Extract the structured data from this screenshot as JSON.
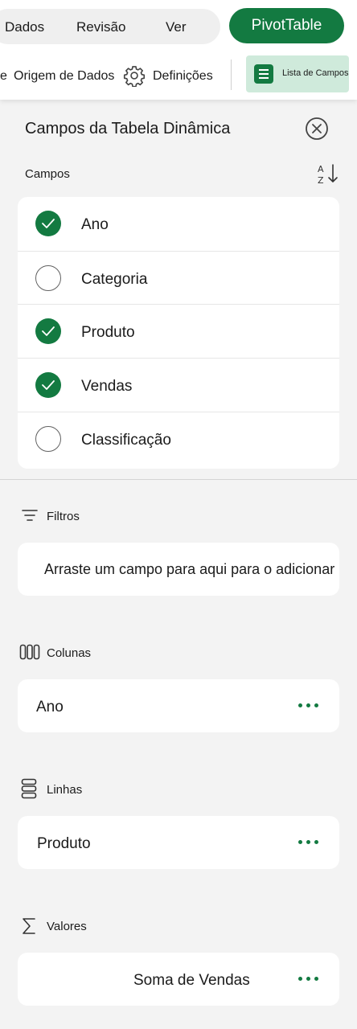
{
  "ribbon": {
    "tabs": [
      "Dados",
      "Revisão",
      "Ver"
    ],
    "pivot_button": "PivotTable",
    "commands": {
      "partial_prev": "e",
      "data_source": "Origem de Dados",
      "settings": "Definições",
      "field_list": "Lista de Campos"
    }
  },
  "panel": {
    "title": "Campos da Tabela Dinâmica",
    "fields_label": "Campos",
    "fields": [
      {
        "label": "Ano",
        "checked": true
      },
      {
        "label": "Categoria",
        "checked": false
      },
      {
        "label": "Produto",
        "checked": true
      },
      {
        "label": "Vendas",
        "checked": true
      },
      {
        "label": "Classificação",
        "checked": false
      }
    ],
    "filters": {
      "label": "Filtros",
      "placeholder": "Arraste um campo para aqui para o adicionar"
    },
    "columns": {
      "label": "Colunas",
      "item": "Ano"
    },
    "rows": {
      "label": "Linhas",
      "item": "Produto"
    },
    "values": {
      "label": "Valores",
      "item": "Soma de Vendas"
    }
  },
  "colors": {
    "accent": "#137a41",
    "accent_light": "#cfeadb",
    "panel_bg": "#f3f3f3",
    "card_bg": "#ffffff"
  },
  "icons": {
    "settings": "gear-icon",
    "field_list": "field-list-icon",
    "close": "close-circle-icon",
    "sort": "sort-az-icon",
    "filters": "filter-icon",
    "columns": "columns-icon",
    "rows": "rows-icon",
    "values": "sigma-icon",
    "more": "more-options-icon"
  }
}
